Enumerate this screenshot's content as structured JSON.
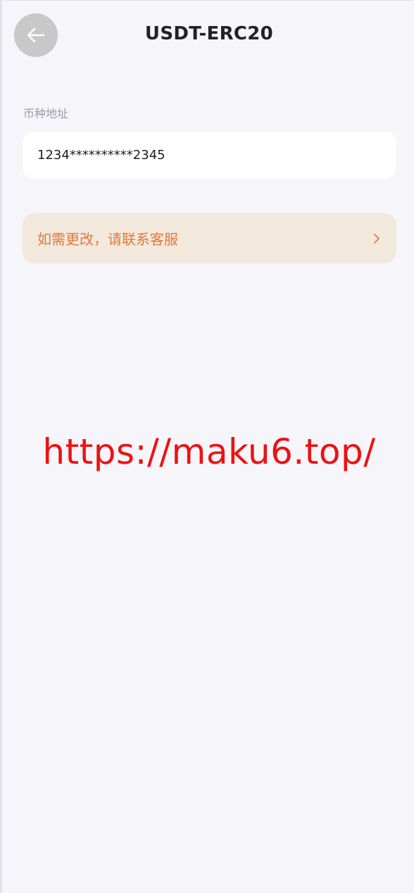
{
  "header": {
    "title": "USDT-ERC20",
    "back_icon": "arrow-left-icon"
  },
  "address": {
    "label": "币种地址",
    "value": "1234**********2345"
  },
  "contact": {
    "label": "如需更改，请联系客服",
    "icon": "chevron-right-icon",
    "accent_color": "#e07a3c",
    "background_color": "#f3e8dc"
  },
  "watermark": {
    "text": "https://maku6.top/",
    "color": "#ee1111"
  }
}
